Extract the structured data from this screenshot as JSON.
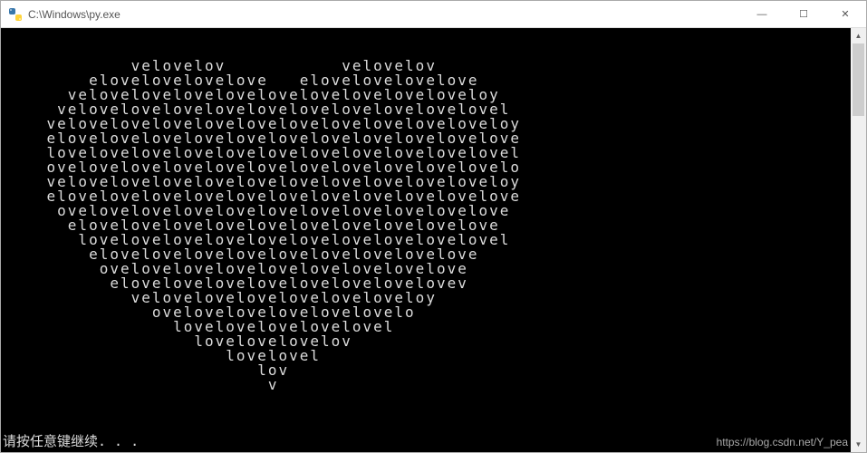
{
  "titlebar": {
    "title": "C:\\Windows\\py.exe",
    "minimize": "—",
    "maximize": "☐",
    "close": "✕"
  },
  "console": {
    "lines": [
      "",
      "",
      "            velovelov           velovelov",
      "        elovelovelovelove   elovelovelovelove",
      "      veloveloveloveloveloveloveloveloveloveloy",
      "     velovelovelovelovelovelovelovelovelovelovel",
      "    veloveloveloveloveloveloveloveloveloveloveloy",
      "    elovelovelovelovelovelovelovelovelovelovelove",
      "    lovelovelovelovelovelovelovelovelovelovelovel",
      "    ovelovelovelovelovelovelovelovelovelovelovelo",
      "    veloveloveloveloveloveloveloveloveloveloveloy",
      "    elovelovelovelovelovelovelovelovelovelovelove",
      "     ovelovelovelovelovelovelovelovelovelovelove",
      "      elovelovelovelovelovelovelovelovelovelove",
      "       lovelovelovelovelovelovelovelovelovelovel",
      "        elovelovelovelovelovelovelovelovelove",
      "         ovelovelovelovelovelovelovelovelove",
      "          elovelovelovelovelovelovelovelovev",
      "            veloveloveloveloveloveloveloy",
      "              ovelovelovelovelovelovelo",
      "                lovelovelovelovelovel",
      "                  lovelovelovelov",
      "                     lovelovel",
      "                        lov",
      "                         v"
    ],
    "prompt": "请按任意键继续. . ."
  },
  "scrollbar": {
    "up": "▲",
    "down": "▼"
  },
  "watermark": "https://blog.csdn.net/Y_pea"
}
